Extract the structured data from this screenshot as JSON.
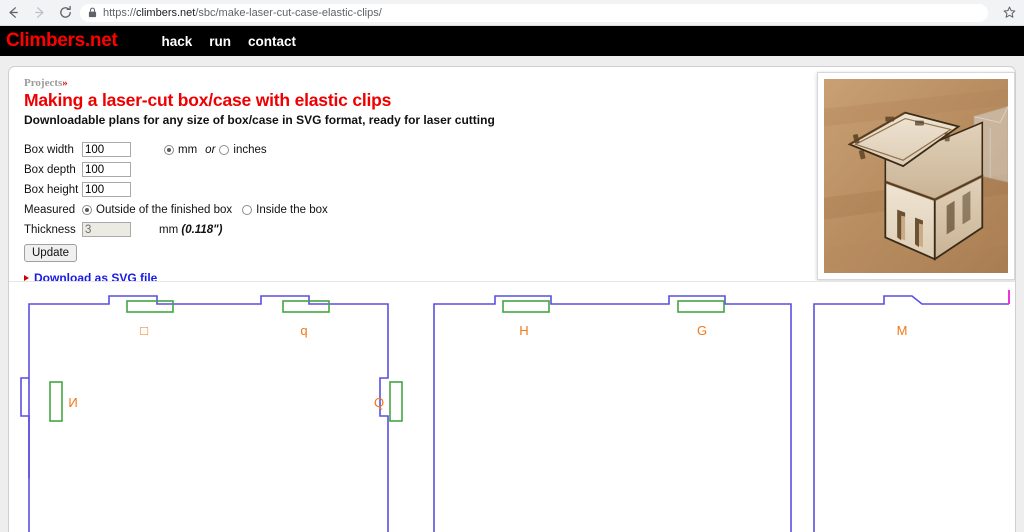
{
  "browser": {
    "back_icon": "back-arrow-icon",
    "forward_icon": "forward-arrow-icon",
    "reload_icon": "reload-icon",
    "lock_icon": "lock-icon",
    "star_icon": "bookmark-star-icon",
    "url_scheme": "https://",
    "url_host": "climbers.net",
    "url_path": "/sbc/make-laser-cut-case-elastic-clips/"
  },
  "site": {
    "brand": "Climbers.net",
    "nav": [
      {
        "label": "hack"
      },
      {
        "label": "run"
      },
      {
        "label": "contact"
      }
    ]
  },
  "content": {
    "breadcrumb_label": "Projects",
    "breadcrumb_chevron": "»",
    "title": "Making a laser-cut box/case with elastic clips",
    "subtitle": "Downloadable plans for any size of box/case in SVG format, ready for laser cutting",
    "download_link": "Download as SVG file",
    "photo_alt": "laser-cut-wooden-box-photo"
  },
  "form": {
    "fields": [
      {
        "label": "Box width",
        "value": "100",
        "disabled": false
      },
      {
        "label": "Box depth",
        "value": "100",
        "disabled": false
      },
      {
        "label": "Box height",
        "value": "100",
        "disabled": false
      }
    ],
    "units": {
      "mm_label": "mm",
      "or_label": "or",
      "inches_label": "inches",
      "selected": "mm"
    },
    "measured": {
      "label": "Measured",
      "outside_label": "Outside of the finished box",
      "inside_label": "Inside the box",
      "selected": "outside"
    },
    "thickness": {
      "label": "Thickness",
      "value": "3",
      "disabled": true,
      "unit": "mm",
      "unit_inches": "(0.118\")"
    },
    "update_button": "Update"
  },
  "plan": {
    "colors": {
      "cut": "#5a4fe0",
      "slot": "#44a544",
      "label": "#f07818",
      "cut_alt": "#ee33dd"
    },
    "panels": [
      {
        "name": "panel-1",
        "labels": [
          "□",
          "q",
          "И",
          "Q"
        ]
      },
      {
        "name": "panel-2",
        "labels": [
          "H",
          "G"
        ]
      },
      {
        "name": "panel-3",
        "labels": [
          "M"
        ]
      }
    ]
  },
  "theme": {
    "brand_red": "#ff0000",
    "title_red": "#ee0000",
    "link_blue": "#1a1ae6",
    "nav_bg": "#000000",
    "page_bg": "#eeeeee"
  }
}
